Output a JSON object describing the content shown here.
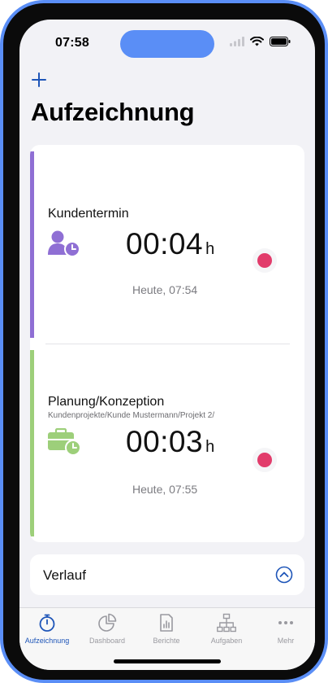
{
  "status_bar": {
    "time": "07:58"
  },
  "header": {
    "title": "Aufzeichnung",
    "add_icon": "plus-icon"
  },
  "colors": {
    "accent": "#1e55b8",
    "record": "#e23c6b",
    "purple": "#8f6fd4",
    "green": "#9dcf7a"
  },
  "entries": [
    {
      "title": "Kundentermin",
      "subtitle": "",
      "icon": "user-clock-icon",
      "timer": "00:04",
      "unit": "h",
      "started": "Heute, 07:54"
    },
    {
      "title": "Planung/Konzeption",
      "subtitle": "Kundenprojekte/Kunde Mustermann/Projekt 2/",
      "icon": "briefcase-clock-icon",
      "timer": "00:03",
      "unit": "h",
      "started": "Heute, 07:55"
    }
  ],
  "verlauf": {
    "label": "Verlauf",
    "icon": "chevron-up-circle-icon"
  },
  "tabs": [
    {
      "label": "Aufzeichnung",
      "icon": "stopwatch-icon",
      "active": true
    },
    {
      "label": "Dashboard",
      "icon": "pie-chart-icon",
      "active": false
    },
    {
      "label": "Berichte",
      "icon": "report-icon",
      "active": false
    },
    {
      "label": "Aufgaben",
      "icon": "hierarchy-icon",
      "active": false
    },
    {
      "label": "Mehr",
      "icon": "more-icon",
      "active": false
    }
  ]
}
